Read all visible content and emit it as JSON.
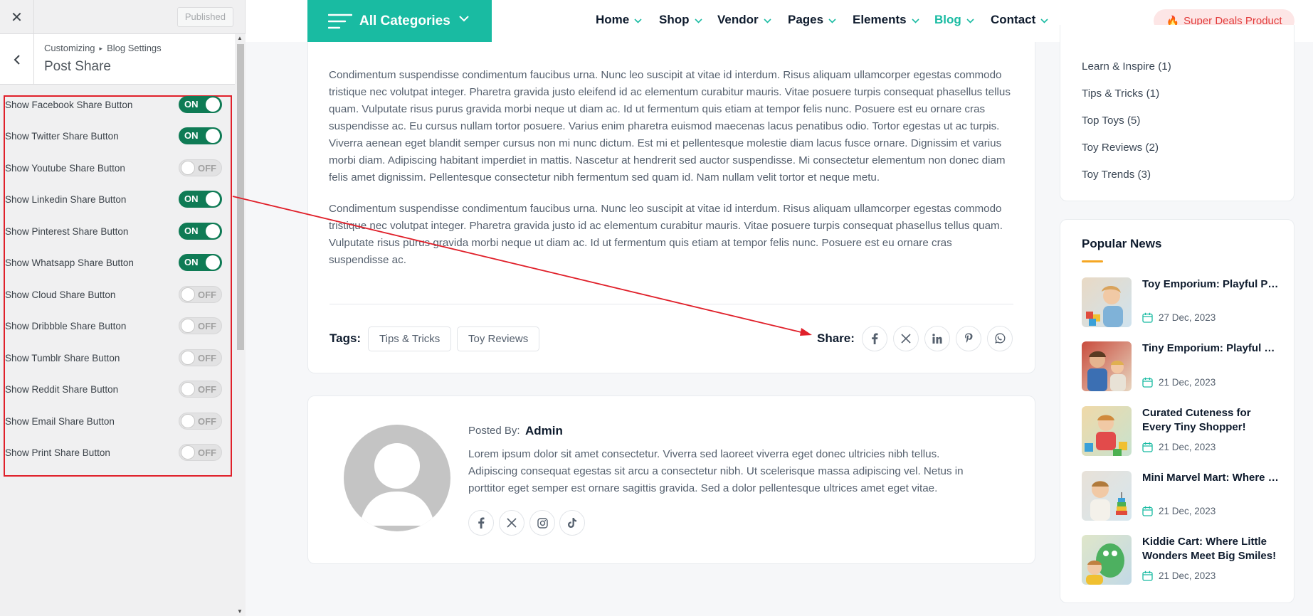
{
  "customizer": {
    "close_glyph": "✕",
    "published_label": "Published",
    "breadcrumb_root": "Customizing",
    "breadcrumb_sep": "▸",
    "breadcrumb_section": "Blog Settings",
    "section_title": "Post Share",
    "controls": [
      {
        "label": "Show Facebook Share Button",
        "state": "ON"
      },
      {
        "label": "Show Twitter Share Button",
        "state": "ON"
      },
      {
        "label": "Show Youtube Share Button",
        "state": "OFF"
      },
      {
        "label": "Show Linkedin Share Button",
        "state": "ON"
      },
      {
        "label": "Show Pinterest Share Button",
        "state": "ON"
      },
      {
        "label": "Show Whatsapp Share Button",
        "state": "ON"
      },
      {
        "label": "Show Cloud Share Button",
        "state": "OFF"
      },
      {
        "label": "Show Dribbble Share Button",
        "state": "OFF"
      },
      {
        "label": "Show Tumblr Share Button",
        "state": "OFF"
      },
      {
        "label": "Show Reddit Share Button",
        "state": "OFF"
      },
      {
        "label": "Show Email Share Button",
        "state": "OFF"
      },
      {
        "label": "Show Print Share Button",
        "state": "OFF"
      }
    ]
  },
  "header": {
    "all_categories_label": "All Categories",
    "nav": [
      {
        "label": "Home"
      },
      {
        "label": "Shop"
      },
      {
        "label": "Vendor"
      },
      {
        "label": "Pages"
      },
      {
        "label": "Elements"
      },
      {
        "label": "Blog",
        "active": true
      },
      {
        "label": "Contact"
      }
    ],
    "deals_label": "Super Deals Product",
    "deals_icon": "🔥",
    "accent_color": "#19bba2"
  },
  "post": {
    "paragraph_1": "Condimentum suspendisse condimentum faucibus urna. Nunc leo suscipit at vitae id interdum. Risus aliquam ullamcorper egestas commodo tristique nec volutpat integer. Pharetra gravida justo eleifend id ac elementum curabitur mauris. Vitae posuere turpis consequat phasellus tellus quam. Vulputate risus purus gravida morbi neque ut diam ac. Id ut fermentum quis etiam at tempor felis nunc. Posuere est eu ornare cras suspendisse ac. Eu cursus nullam tortor posuere. Varius enim pharetra euismod maecenas lacus penatibus odio. Tortor egestas ut ac turpis. Viverra aenean eget blandit semper cursus non mi nunc dictum. Est mi et pellentesque molestie diam lacus fusce ornare. Dignissim et varius morbi diam. Adipiscing habitant imperdiet in mattis. Nascetur at hendrerit sed auctor suspendisse. Mi consectetur elementum non donec diam felis amet dignissim. Pellentesque consectetur nibh fermentum sed quam id. Nam nullam velit tortor et neque metu.",
    "paragraph_2": "Condimentum suspendisse condimentum faucibus urna. Nunc leo suscipit at vitae id interdum. Risus aliquam ullamcorper egestas commodo tristique nec volutpat integer. Pharetra gravida justo id ac elementum curabitur mauris. Vitae posuere turpis consequat phasellus tellus quam. Vulputate risus purus gravida morbi neque ut diam ac. Id ut fermentum quis etiam at tempor felis nunc. Posuere est eu ornare cras suspendisse ac.",
    "tags_label": "Tags:",
    "tags": [
      "Tips & Tricks",
      "Toy Reviews"
    ],
    "share_label": "Share:",
    "share_icons": [
      "facebook-icon",
      "x-twitter-icon",
      "linkedin-icon",
      "pinterest-icon",
      "whatsapp-icon"
    ]
  },
  "author": {
    "posted_by_label": "Posted By:",
    "name": "Admin",
    "bio": "Lorem ipsum dolor sit amet consectetur. Viverra sed laoreet viverra eget donec ultricies nibh tellus. Adipiscing consequat egestas sit arcu a consectetur nibh. Ut scelerisque massa adipiscing vel. Netus in porttitor eget semper est ornare sagittis gravida. Sed a dolor pellentesque ultrices amet eget vitae.",
    "social_icons": [
      "facebook-icon",
      "x-twitter-icon",
      "instagram-icon",
      "tiktok-icon"
    ]
  },
  "sidebar": {
    "categories": [
      "Learn & Inspire (1)",
      "Tips & Tricks (1)",
      "Top Toys (5)",
      "Toy Reviews (2)",
      "Toy Trends (3)"
    ],
    "popular_title": "Popular News",
    "popular_news": [
      {
        "title": "Toy Emporium: Playful Picks for Kids' Delightful...",
        "date": "27 Dec, 2023"
      },
      {
        "title": "Tiny Emporium: Playful Picks for Kids' Delightful...",
        "date": "21 Dec, 2023"
      },
      {
        "title": "Curated Cuteness for Every Tiny Shopper!",
        "date": "21 Dec, 2023"
      },
      {
        "title": "Mini Marvel Mart: Where Every Kid's Wish Comes...",
        "date": "21 Dec, 2023"
      },
      {
        "title": "Kiddie Cart: Where Little Wonders Meet Big Smiles!",
        "date": "21 Dec, 2023"
      }
    ]
  }
}
